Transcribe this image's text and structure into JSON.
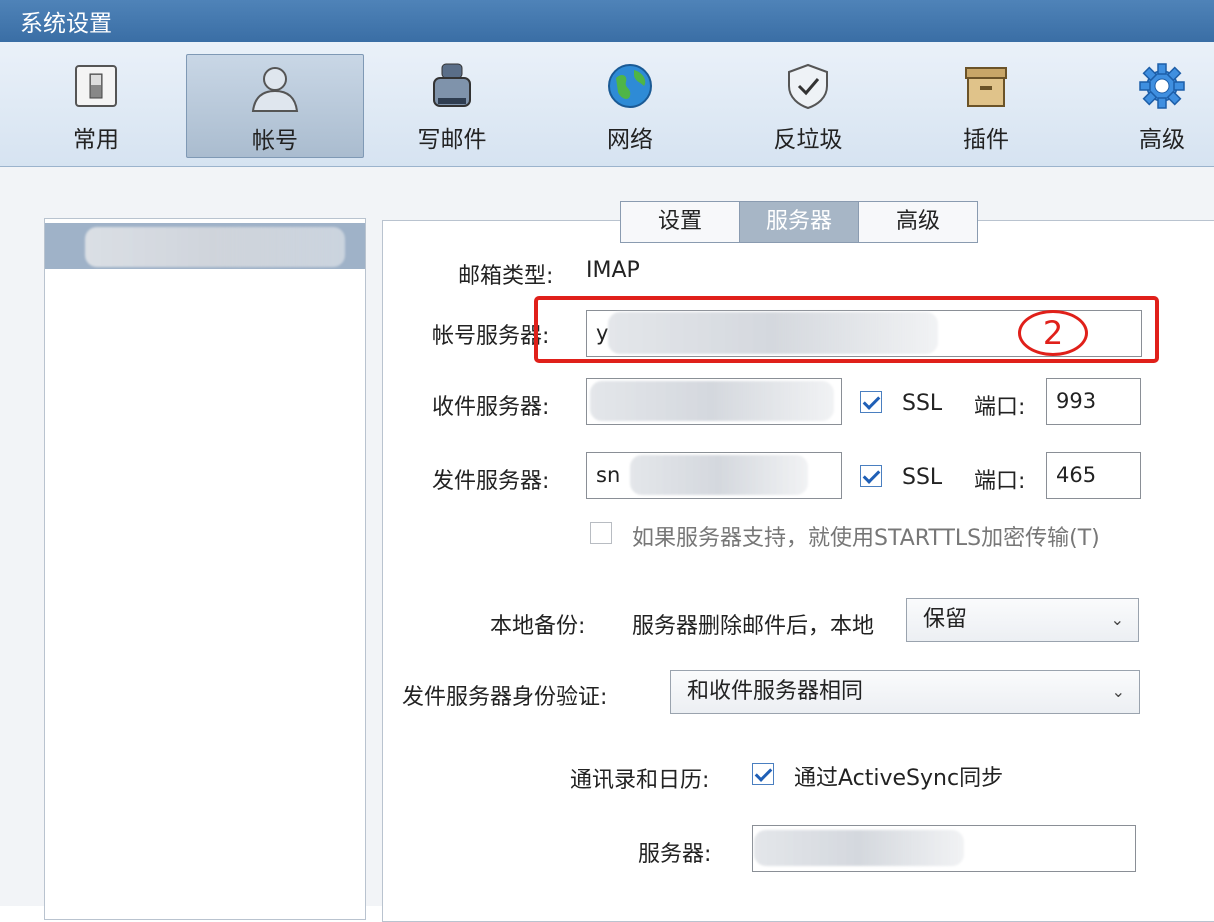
{
  "window": {
    "title": "系统设置"
  },
  "toolbar": {
    "items": [
      {
        "label": "常用",
        "icon": "switch-icon"
      },
      {
        "label": "帐号",
        "icon": "user-icon",
        "active": true
      },
      {
        "label": "写邮件",
        "icon": "compose-icon"
      },
      {
        "label": "网络",
        "icon": "globe-icon"
      },
      {
        "label": "反垃圾",
        "icon": "shield-icon"
      },
      {
        "label": "插件",
        "icon": "box-icon"
      },
      {
        "label": "高级",
        "icon": "gear-icon"
      }
    ]
  },
  "tabs": [
    {
      "label": "设置"
    },
    {
      "label": "服务器",
      "active": true
    },
    {
      "label": "高级"
    }
  ],
  "form": {
    "mailbox_type_label": "邮箱类型:",
    "mailbox_type_value": "IMAP",
    "account_server_label": "帐号服务器:",
    "account_server_value": "y",
    "incoming_server_label": "收件服务器:",
    "incoming_ssl_label": "SSL",
    "incoming_ssl_checked": true,
    "incoming_port_label": "端口:",
    "incoming_port_value": "993",
    "outgoing_server_label": "发件服务器:",
    "outgoing_server_value": "sn",
    "outgoing_ssl_label": "SSL",
    "outgoing_ssl_checked": true,
    "outgoing_port_label": "端口:",
    "outgoing_port_value": "465",
    "starttls_label": "如果服务器支持，就使用STARTTLS加密传输(T)",
    "starttls_checked": false,
    "local_backup_label": "本地备份:",
    "local_backup_desc": "服务器删除邮件后，本地",
    "local_backup_value": "保留",
    "outgoing_auth_label": "发件服务器身份验证:",
    "outgoing_auth_value": "和收件服务器相同",
    "contacts_calendar_label": "通讯录和日历:",
    "activesync_label": "通过ActiveSync同步",
    "activesync_checked": true,
    "server_label": "服务器:"
  },
  "annotation": {
    "marker": "2",
    "color": "#e0201a"
  }
}
